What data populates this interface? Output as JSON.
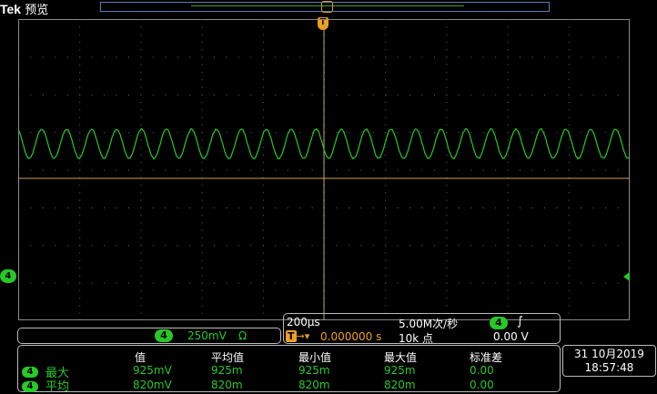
{
  "header": {
    "brand": "Tek",
    "mode": "预览"
  },
  "channel": {
    "id": "4",
    "color": "#28c828",
    "scale": "250mV",
    "coupling_symbol": "Ω"
  },
  "horizontal": {
    "timebase": "200µs",
    "sample_rate": "5.00M次/秒",
    "trigger_position": "0.000000 s",
    "record_length": "10k 点",
    "trigger_source": "4",
    "trigger_slope_symbol": "∫",
    "trigger_level": "0.00 V"
  },
  "measurements": {
    "headers": [
      "值",
      "平均值",
      "最小值",
      "最大值",
      "标准差"
    ],
    "rows": [
      {
        "channel": "4",
        "label": "最大",
        "values": [
          "925mV",
          "925m",
          "925m",
          "925m",
          "0.00"
        ]
      },
      {
        "channel": "4",
        "label": "平均",
        "values": [
          "820mV",
          "820m",
          "820m",
          "820m",
          "0.00"
        ]
      }
    ]
  },
  "datetime": {
    "date": "31 10月2019",
    "time": "18:57:48"
  },
  "colors": {
    "trace": "#28c828",
    "trigger": "#f0a020",
    "grid": "#8a8a8a",
    "axis": "#c8a060"
  },
  "trigger_marker": "T"
}
